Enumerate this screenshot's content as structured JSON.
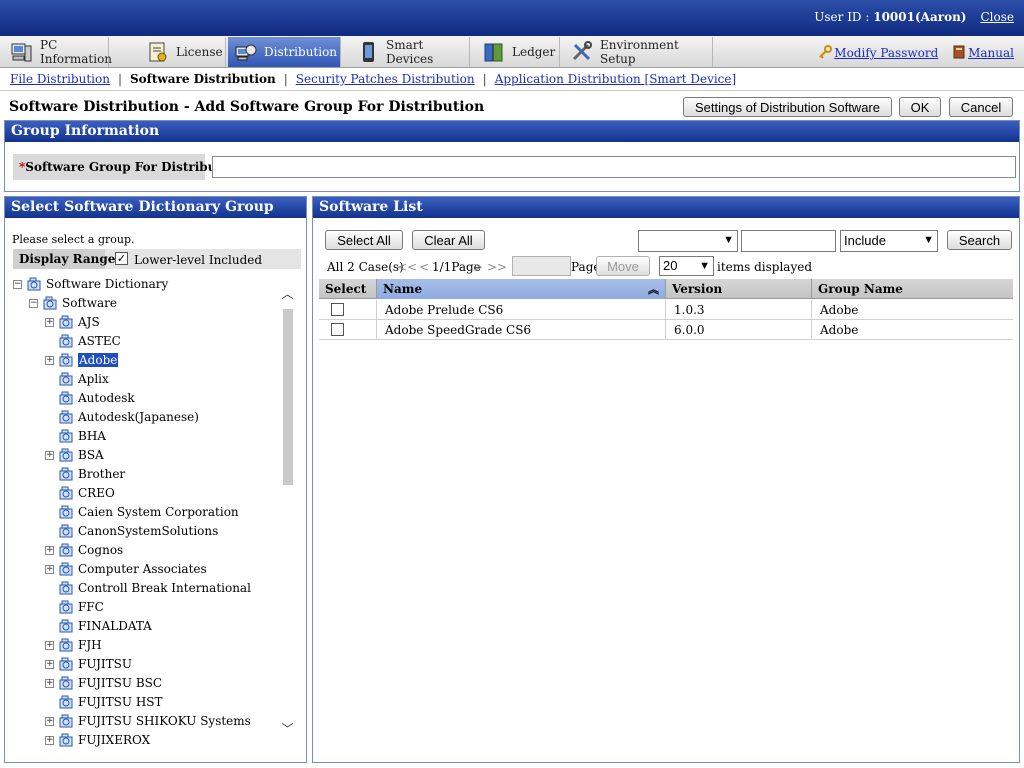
{
  "header": {
    "user_label": "User ID : ",
    "user_id": "10001(Aaron)",
    "close": "Close"
  },
  "tabs": [
    {
      "label": "PC Information",
      "icon": "pc-icon"
    },
    {
      "label": "License",
      "icon": "license-icon"
    },
    {
      "label": "Distribution",
      "icon": "distribution-icon",
      "active": true
    },
    {
      "label": "Smart Devices",
      "icon": "smartphone-icon"
    },
    {
      "label": "Ledger",
      "icon": "ledger-icon"
    },
    {
      "label": "Environment Setup",
      "icon": "tools-icon"
    }
  ],
  "toplinks": {
    "modify_password": "Modify Password",
    "manual": "Manual"
  },
  "subnav": {
    "file_distribution": "File Distribution",
    "software_distribution": "Software Distribution",
    "security_patches": "Security Patches Distribution",
    "application_distribution": "Application Distribution [Smart Device]"
  },
  "page": {
    "title": "Software Distribution - Add Software Group For Distribution",
    "settings_button": "Settings of Distribution Software",
    "ok_button": "OK",
    "cancel_button": "Cancel"
  },
  "group_info": {
    "title": "Group Information",
    "required_mark": "*",
    "field_label": "Software Group For Distribution",
    "field_value": ""
  },
  "dictionary": {
    "title": "Select Software Dictionary Group",
    "hint": "Please select a group.",
    "range_label": "Display Range",
    "lower_level_checked": true,
    "lower_level_label": "Lower-level Included",
    "root": "Software Dictionary",
    "child": "Software",
    "items": [
      {
        "label": "AJS",
        "expandable": true
      },
      {
        "label": "ASTEC",
        "expandable": false
      },
      {
        "label": "Adobe",
        "expandable": true,
        "selected": true
      },
      {
        "label": "Aplix",
        "expandable": false
      },
      {
        "label": "Autodesk",
        "expandable": false
      },
      {
        "label": "Autodesk(Japanese)",
        "expandable": false
      },
      {
        "label": "BHA",
        "expandable": false
      },
      {
        "label": "BSA",
        "expandable": true
      },
      {
        "label": "Brother",
        "expandable": false
      },
      {
        "label": "CREO",
        "expandable": false
      },
      {
        "label": "Caien System Corporation",
        "expandable": false
      },
      {
        "label": "CanonSystemSolutions",
        "expandable": false
      },
      {
        "label": "Cognos",
        "expandable": true
      },
      {
        "label": "Computer Associates",
        "expandable": true
      },
      {
        "label": "Controll Break International",
        "expandable": false
      },
      {
        "label": "FFC",
        "expandable": false
      },
      {
        "label": "FINALDATA",
        "expandable": false
      },
      {
        "label": "FJH",
        "expandable": true
      },
      {
        "label": "FUJITSU",
        "expandable": true
      },
      {
        "label": "FUJITSU BSC",
        "expandable": true
      },
      {
        "label": "FUJITSU HST",
        "expandable": false
      },
      {
        "label": "FUJITSU SHIKOKU Systems",
        "expandable": true
      },
      {
        "label": "FUJIXEROX",
        "expandable": true
      }
    ]
  },
  "software_list": {
    "title": "Software List",
    "select_all": "Select All",
    "clear_all": "Clear All",
    "filter_field_value": "",
    "filter_text_value": "",
    "filter_match": "Include",
    "search": "Search",
    "case_count": "All 2 Case(s)",
    "nav_first": "<<",
    "nav_prev": "<",
    "page_info": "1/1Page",
    "nav_next": ">",
    "nav_last": ">>",
    "page_input": "",
    "page_label": "Page",
    "move": "Move",
    "per_page": "20",
    "items_displayed": "items displayed",
    "columns": [
      "Select",
      "Name",
      "Version",
      "Group Name"
    ],
    "rows": [
      {
        "name": "Adobe Prelude CS6",
        "version": "1.0.3",
        "group": "Adobe"
      },
      {
        "name": "Adobe SpeedGrade CS6",
        "version": "6.0.0",
        "group": "Adobe"
      }
    ]
  }
}
